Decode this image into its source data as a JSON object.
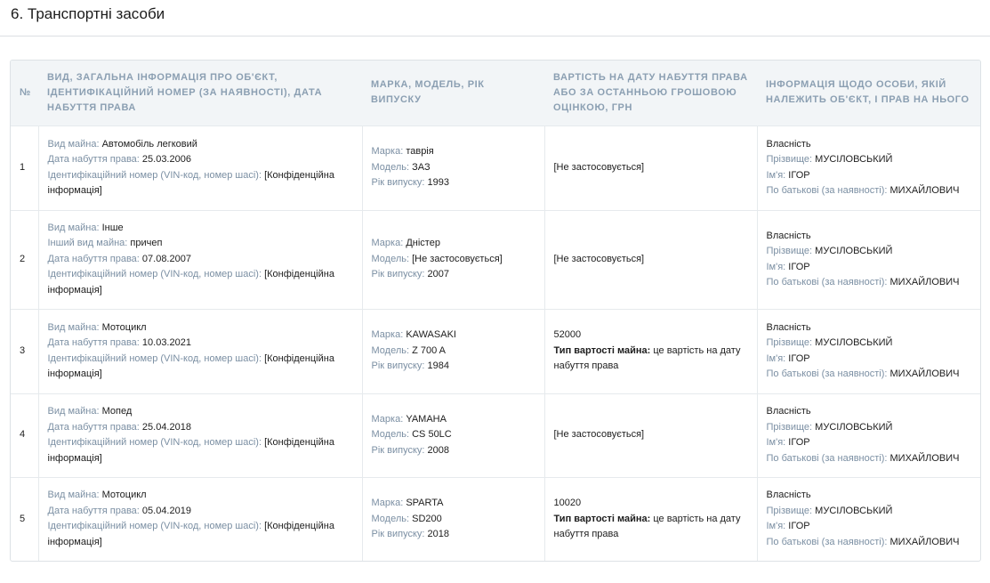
{
  "section": {
    "title": "6. Транспортні засоби"
  },
  "columns": {
    "num": "№",
    "info": "Вид, загальна інформація про об'єкт, ідентифікаційний номер (за наявності), дата набуття права",
    "brand": "Марка, модель, рік випуску",
    "value": "Вартість на дату набуття права або за останньою грошовою оцінкою, грн",
    "owner": "Інформація щодо особи, якій належить об'єкт, і прав на нього"
  },
  "labels": {
    "property_type": "Вид майна:",
    "other_type": "Інший вид майна:",
    "acquired": "Дата набуття права:",
    "vin": "Ідентифікаційний номер (VIN-код, номер шасі):",
    "brand": "Марка:",
    "model": "Модель:",
    "year": "Рік випуску:",
    "value_type": "Тип вартості майна:",
    "ownership": "Власність",
    "surname": "Прізвище:",
    "name": "Ім'я:",
    "patronymic": "По батькові (за наявності):"
  },
  "rows": [
    {
      "num": "1",
      "type": "Автомобіль легковий",
      "acquired": "25.03.2006",
      "vin": "[Конфіденційна інформація]",
      "brand": "таврія",
      "model": "ЗАЗ",
      "year": "1993",
      "value": "[Не застосовується]",
      "owner": {
        "surname": "МУСІЛОВСЬКИЙ",
        "name": "ІГОР",
        "patronymic": "МИХАЙЛОВИЧ"
      }
    },
    {
      "num": "2",
      "type": "Інше",
      "other_type": "причеп",
      "acquired": "07.08.2007",
      "vin": "[Конфіденційна інформація]",
      "brand": "Дністер",
      "model": "[Не застосовується]",
      "year": "2007",
      "value": "[Не застосовується]",
      "owner": {
        "surname": "МУСІЛОВСЬКИЙ",
        "name": "ІГОР",
        "patronymic": "МИХАЙЛОВИЧ"
      }
    },
    {
      "num": "3",
      "type": "Мотоцикл",
      "acquired": "10.03.2021",
      "vin": "[Конфіденційна інформація]",
      "brand": "KAWASAKI",
      "model": "Z 700 A",
      "year": "1984",
      "value": "52000",
      "value_type": "це вартість на дату набуття права",
      "owner": {
        "surname": "МУСІЛОВСЬКИЙ",
        "name": "ІГОР",
        "patronymic": "МИХАЙЛОВИЧ"
      }
    },
    {
      "num": "4",
      "type": "Мопед",
      "acquired": "25.04.2018",
      "vin": "[Конфіденційна інформація]",
      "brand": "YAMAHA",
      "model": "CS 50LC",
      "year": "2008",
      "value": "[Не застосовується]",
      "owner": {
        "surname": "МУСІЛОВСЬКИЙ",
        "name": "ІГОР",
        "patronymic": "МИХАЙЛОВИЧ"
      }
    },
    {
      "num": "5",
      "type": "Мотоцикл",
      "acquired": "05.04.2019",
      "vin": "[Конфіденційна інформація]",
      "brand": "SPARTA",
      "model": "SD200",
      "year": "2018",
      "value": "10020",
      "value_type": "це вартість на дату набуття права",
      "owner": {
        "surname": "МУСІЛОВСЬКИЙ",
        "name": "ІГОР",
        "patronymic": "МИХАЙЛОВИЧ"
      }
    }
  ]
}
